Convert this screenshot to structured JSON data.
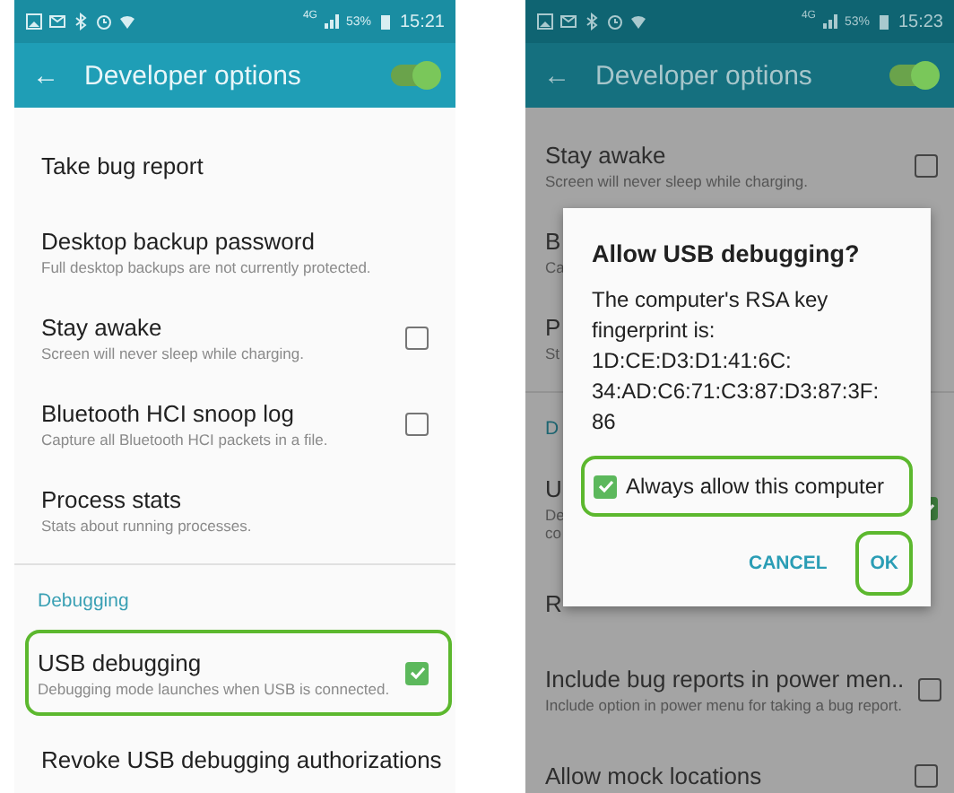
{
  "left_phone": {
    "status_bar": {
      "network": "4G",
      "battery": "53%",
      "time": "15:21"
    },
    "app_bar": {
      "back": "←",
      "title": "Developer options",
      "toggle": {
        "on": true
      }
    },
    "items": [
      {
        "kind": "item",
        "title": "Take bug report",
        "highlighted": false
      },
      {
        "kind": "item",
        "title": "Desktop backup password",
        "subtitle": "Full desktop backups are not currently protected.",
        "highlighted": false
      },
      {
        "kind": "check",
        "title": "Stay awake",
        "subtitle": "Screen will never sleep while charging.",
        "checked": false,
        "highlighted": false
      },
      {
        "kind": "check",
        "title": "Bluetooth HCI snoop log",
        "subtitle": "Capture all Bluetooth HCI packets in a file.",
        "checked": false,
        "highlighted": false
      },
      {
        "kind": "item",
        "title": "Process stats",
        "subtitle": "Stats about running processes.",
        "highlighted": false
      },
      {
        "kind": "header",
        "title": "Debugging"
      },
      {
        "kind": "check",
        "title": "USB debugging",
        "subtitle": "Debugging mode launches when USB is connected.",
        "checked": true,
        "highlighted": true
      },
      {
        "kind": "item",
        "title": "Revoke USB debugging authorizations",
        "highlighted": false
      }
    ]
  },
  "right_phone": {
    "status_bar": {
      "network": "4G",
      "battery": "53%",
      "time": "15:23"
    },
    "app_bar": {
      "back": "←",
      "title": "Developer options",
      "toggle": {
        "on": true
      }
    },
    "items": [
      {
        "kind": "check",
        "title": "Stay awake",
        "subtitle": "Screen will never sleep while charging.",
        "checked": false
      },
      {
        "kind": "item",
        "title": "B",
        "subtitle": "Ca"
      },
      {
        "kind": "item",
        "title": "P",
        "subtitle": "St"
      },
      {
        "kind": "header",
        "title": "D"
      },
      {
        "kind": "check",
        "title": "U",
        "subtitle": "De co",
        "checked": true
      },
      {
        "kind": "item",
        "title": "R"
      },
      {
        "kind": "check",
        "title": "Include bug reports in power men..",
        "subtitle": "Include option in power menu for taking a bug report.",
        "checked": false
      },
      {
        "kind": "check",
        "title": "Allow mock locations",
        "checked": false
      }
    ],
    "dialog": {
      "title": "Allow USB debugging?",
      "message_lines": [
        "The computer's RSA key",
        "fingerprint is:",
        "1D:CE:D3:D1:41:6C:",
        "34:AD:C6:71:C3:87:D3:87:3F:",
        "86"
      ],
      "checkbox": {
        "label": "Always allow this computer",
        "checked": true,
        "highlighted": true
      },
      "buttons": [
        {
          "label": "CANCEL",
          "highlighted": false
        },
        {
          "label": "OK",
          "highlighted": true
        }
      ]
    }
  }
}
